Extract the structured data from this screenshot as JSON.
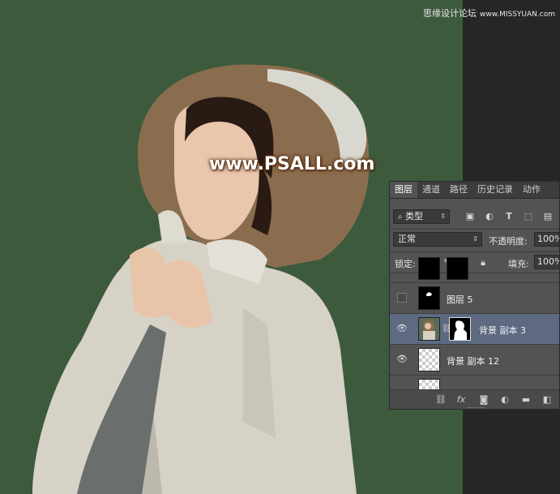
{
  "watermark_top": {
    "text": "思缘设计论坛",
    "site": "www.MISSYUAN.com"
  },
  "photo_watermark": "www.PSALL.com",
  "colors": {
    "background": "#3d5a3d",
    "panel": "#535353",
    "selected": "#5d6a82"
  },
  "panel": {
    "tabs": [
      "图层",
      "通道",
      "路径",
      "历史记录",
      "动作"
    ],
    "active_tab": "图层",
    "filter": {
      "kind_label": "类型",
      "icons": [
        "image-icon",
        "adjust-icon",
        "type-icon",
        "shape-icon",
        "smart-object-icon"
      ]
    },
    "blend_mode": "正常",
    "opacity_label": "不透明度:",
    "opacity_value": "100%",
    "lock_label": "锁定:",
    "fill_label": "填充:",
    "fill_value": "100%",
    "layers": [
      {
        "name": "图层 5",
        "visible": false,
        "selected": false
      },
      {
        "name": "背景 副本 3",
        "visible": true,
        "selected": true,
        "has_mask": true
      },
      {
        "name": "背景 副本 12",
        "visible": true,
        "selected": false
      }
    ],
    "bottom_icons": [
      "link-icon",
      "fx-icon",
      "mask-icon",
      "adjustment-icon",
      "folder-icon",
      "new-layer-icon"
    ],
    "fx_label": "fx"
  }
}
